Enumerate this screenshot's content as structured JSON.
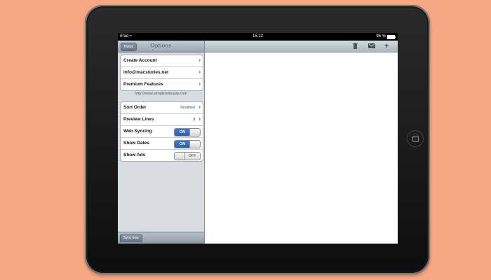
{
  "statusbar": {
    "device": "iPad",
    "time": "15.22",
    "battery": "96 %",
    "battery_level": 0.96
  },
  "options_panel": {
    "back_label": "Notes",
    "title": "Options",
    "account_group": [
      {
        "label": "Create Account"
      },
      {
        "label": "info@macstories.net"
      },
      {
        "label": "Premium Features"
      }
    ],
    "url": "http://www.simplenoteapp.com",
    "settings": {
      "sort_order": {
        "label": "Sort Order",
        "value": "Modified"
      },
      "preview_lines": {
        "label": "Preview Lines",
        "value": "3"
      },
      "web_syncing": {
        "label": "Web Syncing",
        "state": "ON"
      },
      "show_dates": {
        "label": "Show Dates",
        "state": "ON"
      },
      "show_ads": {
        "label": "Show Ads",
        "state": "OFF"
      }
    },
    "sync_label": "Sync now"
  },
  "toolbar": {
    "icons": [
      "trash-icon",
      "mail-icon",
      "plus-icon"
    ]
  },
  "colors": {
    "background": "#f6a882",
    "toggle_on": "#2a5eb8",
    "value_text": "#3c5a8f"
  }
}
